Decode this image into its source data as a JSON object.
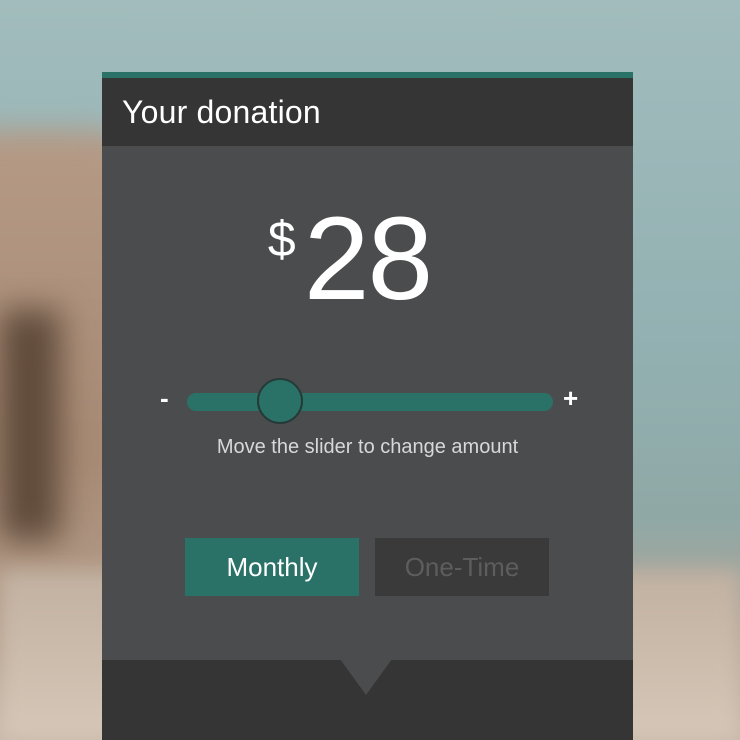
{
  "header": {
    "title": "Your donation"
  },
  "amount": {
    "currency": "$",
    "value": "28"
  },
  "slider": {
    "decrease_label": "-",
    "increase_label": "+",
    "level_fraction": 0.22,
    "hint": "Move the slider to change amount"
  },
  "frequency": {
    "options": [
      "Monthly",
      "One-Time"
    ],
    "selected": "Monthly"
  },
  "colors": {
    "accent": "#2a7268",
    "header_bg": "#353535",
    "panel_bg": "#4b4c4d"
  }
}
